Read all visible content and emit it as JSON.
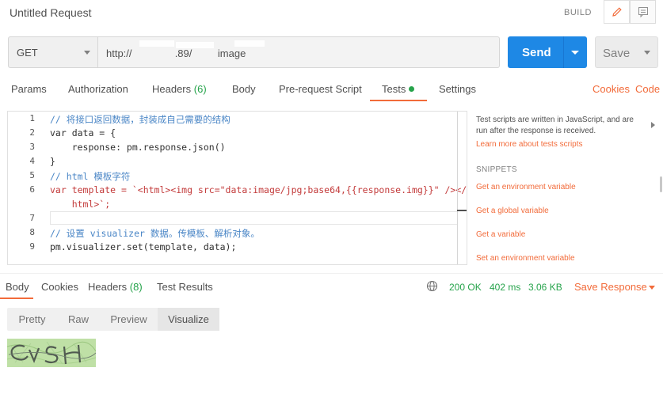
{
  "header": {
    "title": "Untitled Request",
    "build_label": "BUILD"
  },
  "request": {
    "method": "GET",
    "url": "http://               .89/         image",
    "send_label": "Send",
    "save_label": "Save"
  },
  "tabs": {
    "params": "Params",
    "authorization": "Authorization",
    "headers": "Headers",
    "headers_count": "(6)",
    "body": "Body",
    "prerequest": "Pre-request Script",
    "tests": "Tests",
    "settings": "Settings",
    "cookies": "Cookies",
    "code": "Code"
  },
  "editor": {
    "line_numbers": [
      "1",
      "2",
      "3",
      "4",
      "5",
      "6",
      "7",
      "8",
      "9"
    ],
    "lines": [
      "// 将接口返回数据，封装成自己需要的结构",
      "var data = {",
      "    response: pm.response.json()",
      "}",
      "// html 模板字符",
      "var template = `<html><img src=\"data:image/jpg;base64,{{response.img}}\" /></",
      "    html>`;",
      "",
      "// 设置 visualizer 数据。传模板、解析对象。",
      "pm.visualizer.set(template, data);"
    ]
  },
  "sidebar": {
    "description": "Test scripts are written in JavaScript, and are run after the response is received.",
    "learn_more": "Learn more about tests scripts",
    "snippets_heading": "SNIPPETS",
    "snippets": [
      "Get an environment variable",
      "Get a global variable",
      "Get a variable",
      "Set an environment variable"
    ]
  },
  "response": {
    "tabs": {
      "body": "Body",
      "cookies": "Cookies",
      "headers": "Headers",
      "headers_count": "(8)",
      "test_results": "Test Results"
    },
    "status": "200 OK",
    "time": "402 ms",
    "size": "3.06 KB",
    "save_response": "Save Response",
    "views": [
      "Pretty",
      "Raw",
      "Preview",
      "Visualize"
    ],
    "active_view": "Visualize"
  },
  "colors": {
    "accent": "#f26b3a",
    "send": "#1e88e5",
    "success": "#26a34b"
  }
}
